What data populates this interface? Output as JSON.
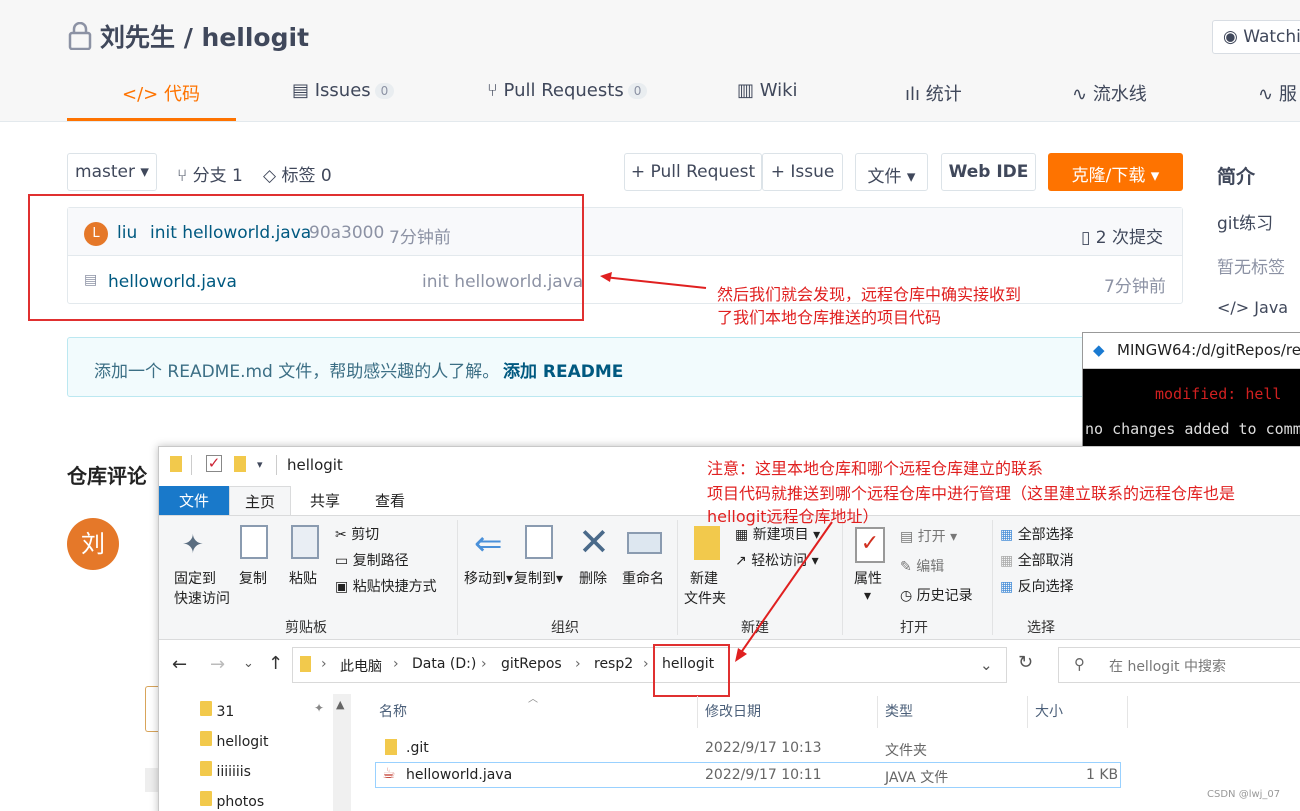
{
  "repo": {
    "title": "刘先生 / hellogit",
    "watch_label": "Watchin"
  },
  "tabs": [
    {
      "label": "</> 代码"
    },
    {
      "label": "Issues",
      "count": "0"
    },
    {
      "label": "Pull Requests",
      "count": "0"
    },
    {
      "label": "Wiki"
    },
    {
      "label": "统计"
    },
    {
      "label": "流水线"
    },
    {
      "label": "服"
    }
  ],
  "toolbar": {
    "branch": "master",
    "branches": "分支 1",
    "tags": "标签 0",
    "pull_request": "+ Pull Request",
    "issue": "+ Issue",
    "file": "文件",
    "web_ide": "Web IDE",
    "clone": "克隆/下载"
  },
  "commit": {
    "avatar": "L",
    "author": "liu",
    "message": "init helloworld.java",
    "hash": "90a3000",
    "time": "7分钟前",
    "count": "2 次提交"
  },
  "files": [
    {
      "name": "helloworld.java",
      "message": "init helloworld.java",
      "time": "7分钟前"
    }
  ],
  "readme": {
    "text": "添加一个 README.md 文件，帮助感兴趣的人了解。",
    "link": "添加 README"
  },
  "sidebar": {
    "title": "简介",
    "desc": "git练习",
    "tags": "暂无标签",
    "lang": "Java"
  },
  "comments": {
    "title": "仓库评论",
    "avatar": "刘"
  },
  "annotations": {
    "a1_l1": "然后我们就会发现，远程仓库中确实接收到",
    "a1_l2": "了我们本地仓库推送的项目代码",
    "a2_l1": "注意：这里本地仓库和哪个远程仓库建立的联系",
    "a2_l2": "项目代码就推送到哪个远程仓库中进行管理（这里建立联系的远程仓库也是",
    "a2_l3": "hellogit远程仓库地址）"
  },
  "terminal": {
    "title": "MINGW64:/d/gitRepos/re",
    "line1_label": "modified:",
    "line1_file": "hell",
    "line2": "no changes added to comm"
  },
  "explorer": {
    "title": "hellogit",
    "tabs": [
      "文件",
      "主页",
      "共享",
      "查看"
    ],
    "clipboard": {
      "pin": "固定到",
      "pin2": "快速访问",
      "copy": "复制",
      "paste": "粘贴",
      "cut": "剪切",
      "copy_path": "复制路径",
      "paste_shortcut": "粘贴快捷方式",
      "group": "剪贴板"
    },
    "organize": {
      "move": "移动到",
      "copy_to": "复制到",
      "delete": "删除",
      "rename": "重命名",
      "group": "组织"
    },
    "new": {
      "new_folder": "新建",
      "new_folder2": "文件夹",
      "new_item": "新建项目",
      "easy_access": "轻松访问",
      "group": "新建"
    },
    "open": {
      "props": "属性",
      "open": "打开",
      "edit": "编辑",
      "history": "历史记录",
      "group": "打开"
    },
    "select": {
      "all": "全部选择",
      "none": "全部取消",
      "invert": "反向选择",
      "group": "选择"
    },
    "path": [
      "此电脑",
      "Data (D:)",
      "gitRepos",
      "resp2",
      "hellogit"
    ],
    "search_placeholder": "在 hellogit 中搜索",
    "nav": [
      "31",
      "hellogit",
      "iiiiiiis",
      "photos"
    ],
    "columns": {
      "name": "名称",
      "date": "修改日期",
      "type": "类型",
      "size": "大小"
    },
    "rows": [
      {
        "name": ".git",
        "date": "2022/9/17 10:13",
        "type": "文件夹",
        "size": ""
      },
      {
        "name": "helloworld.java",
        "date": "2022/9/17 10:11",
        "type": "JAVA 文件",
        "size": "1 KB"
      }
    ]
  },
  "watermark": "CSDN @lwj_07"
}
